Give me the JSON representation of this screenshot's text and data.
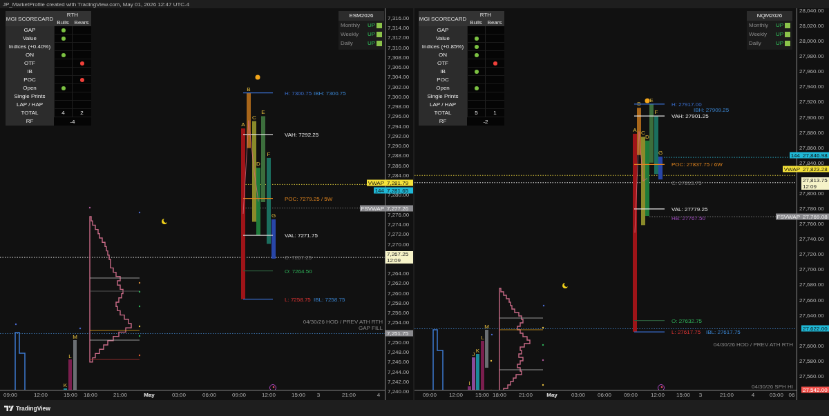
{
  "header": {
    "text": "JP_MarketProfile created with TradingView.com, May 01, 2026 12:47 UTC-4"
  },
  "panes": [
    {
      "symbol": "ESM2026",
      "trend": [
        {
          "period": "Monthly",
          "direction": "UP",
          "up": true
        },
        {
          "period": "Weekly",
          "direction": "UP",
          "up": true
        },
        {
          "period": "Daily",
          "direction": "UP",
          "up": true
        }
      ],
      "scorecard": {
        "title": "MGI SCORECARD",
        "session": "RTH",
        "columns": [
          "Bulls",
          "Bears"
        ],
        "rows": [
          {
            "label": "GAP",
            "bull": true,
            "bear": false
          },
          {
            "label": "Value",
            "bull": true,
            "bear": false
          },
          {
            "label": "Indices (+0.40%)",
            "bull": false,
            "bear": false
          },
          {
            "label": "ON",
            "bull": true,
            "bear": false
          },
          {
            "label": "OTF",
            "bull": false,
            "bear": true
          },
          {
            "label": "IB",
            "bull": false,
            "bear": false
          },
          {
            "label": "POC",
            "bull": false,
            "bear": true
          },
          {
            "label": "Open",
            "bull": true,
            "bear": false
          },
          {
            "label": "Single Prints",
            "bull": false,
            "bear": false
          },
          {
            "label": "LAP / HAP",
            "bull": false,
            "bear": false
          }
        ],
        "total_label": "TOTAL",
        "totals": [
          "4",
          "2"
        ],
        "rf_label": "RF",
        "rf": "-4"
      },
      "periods": [
        {
          "letter": "A",
          "color": "#9e1418"
        },
        {
          "letter": "B",
          "color": "#a8661a"
        },
        {
          "letter": "C",
          "color": "#8a8a2a"
        },
        {
          "letter": "D",
          "color": "#1f7a3a"
        },
        {
          "letter": "E",
          "color": "#3c6e3c"
        },
        {
          "letter": "F",
          "color": "#1b6e5e"
        },
        {
          "letter": "G",
          "color": "#2846a8"
        }
      ],
      "prior_periods": [
        {
          "letter": "K",
          "color": "#1a8a9a"
        },
        {
          "letter": "L",
          "color": "#7a1e4e"
        },
        {
          "letter": "M",
          "color": "#6a6e72"
        }
      ],
      "levels": [
        {
          "text": "H: 7300.75",
          "kind": "high"
        },
        {
          "text": "IBH: 7300.75",
          "kind": "ib"
        },
        {
          "text": "VAH: 7292.25",
          "kind": "value"
        },
        {
          "text": "POC: 7279.25 / 5W",
          "kind": "poc"
        },
        {
          "text": "VAL: 7271.75",
          "kind": "value"
        },
        {
          "text": "C: 7267.25",
          "kind": "close"
        },
        {
          "text": "O: 7264.50",
          "kind": "open"
        },
        {
          "text": "L: 7258.75",
          "kind": "low"
        },
        {
          "text": "IBL: 7258.75",
          "kind": "ib"
        }
      ],
      "notes": [
        "04/30/26 HOD / PREV ATH RTH",
        "GAP FILL"
      ],
      "price_ticks": [
        "7,316.00",
        "7,314.00",
        "7,312.00",
        "7,310.00",
        "7,308.00",
        "7,306.00",
        "7,304.00",
        "7,302.00",
        "7,300.00",
        "7,298.00",
        "7,296.00",
        "7,294.00",
        "7,292.00",
        "7,290.00",
        "7,288.00",
        "7,286.00",
        "7,284.00",
        "7,280.00",
        "7,276.00",
        "7,274.00",
        "7,272.00",
        "7,270.00",
        "7,264.00",
        "7,262.00",
        "7,260.00",
        "7,258.00",
        "7,256.00",
        "7,254.00",
        "7,250.00",
        "7,248.00",
        "7,246.00",
        "7,244.00",
        "7,242.00",
        "7,240.00"
      ],
      "badges": [
        {
          "label": "VWAP",
          "value": "7,281.79",
          "kind": "vwap"
        },
        {
          "label": "144",
          "value": "7,281.65",
          "kind": "ma"
        },
        {
          "label": "FSVWAP",
          "value": "7,277.26",
          "kind": "fsvwap"
        },
        {
          "value": "7,267.25",
          "time": "12:09",
          "kind": "last"
        },
        {
          "value": "7,251.75",
          "kind": "level"
        }
      ],
      "time_ticks": [
        {
          "label": "09:00",
          "major": false
        },
        {
          "label": "12:00",
          "major": false
        },
        {
          "label": "15:00",
          "major": false
        },
        {
          "label": "18:00",
          "major": false
        },
        {
          "label": "21:00",
          "major": false
        },
        {
          "label": "May",
          "major": true
        },
        {
          "label": "03:00",
          "major": false
        },
        {
          "label": "06:00",
          "major": false
        },
        {
          "label": "09:00",
          "major": false
        },
        {
          "label": "12:00",
          "major": false
        },
        {
          "label": "15:00",
          "major": false
        },
        {
          "label": "3",
          "major": false
        },
        {
          "label": "21:00",
          "major": false
        },
        {
          "label": "4",
          "major": false
        }
      ]
    },
    {
      "symbol": "NQM2026",
      "trend": [
        {
          "period": "Monthly",
          "direction": "UP",
          "up": true
        },
        {
          "period": "Weekly",
          "direction": "UP",
          "up": true
        },
        {
          "period": "Daily",
          "direction": "UP",
          "up": true
        }
      ],
      "scorecard": {
        "title": "MGI SCORECARD",
        "session": "RTH",
        "columns": [
          "Bulls",
          "Bears"
        ],
        "rows": [
          {
            "label": "GAP",
            "bull": false,
            "bear": false
          },
          {
            "label": "Value",
            "bull": true,
            "bear": false
          },
          {
            "label": "Indices (+0.85%)",
            "bull": true,
            "bear": false
          },
          {
            "label": "ON",
            "bull": true,
            "bear": false
          },
          {
            "label": "OTF",
            "bull": false,
            "bear": true
          },
          {
            "label": "IB",
            "bull": true,
            "bear": false
          },
          {
            "label": "POC",
            "bull": false,
            "bear": false
          },
          {
            "label": "Open",
            "bull": true,
            "bear": false
          },
          {
            "label": "Single Prints",
            "bull": false,
            "bear": false
          },
          {
            "label": "LAP / HAP",
            "bull": false,
            "bear": false
          }
        ],
        "total_label": "TOTAL",
        "totals": [
          "5",
          "1"
        ],
        "rf_label": "RF",
        "rf": "-2"
      },
      "periods": [
        {
          "letter": "A",
          "color": "#9e1418"
        },
        {
          "letter": "B",
          "color": "#a8661a"
        },
        {
          "letter": "C",
          "color": "#8a8a2a"
        },
        {
          "letter": "D",
          "color": "#1f7a3a"
        },
        {
          "letter": "E",
          "color": "#3c6e3c"
        },
        {
          "letter": "F",
          "color": "#1b6e5e"
        },
        {
          "letter": "G",
          "color": "#2846a8"
        }
      ],
      "prior_periods": [
        {
          "letter": "I",
          "color": "#7a2e6e"
        },
        {
          "letter": "J",
          "color": "#8a4a9a"
        },
        {
          "letter": "K",
          "color": "#1a8a9a"
        },
        {
          "letter": "L",
          "color": "#7a1e4e"
        },
        {
          "letter": "M",
          "color": "#6a6e72"
        }
      ],
      "levels": [
        {
          "text": "H: 27917.00",
          "kind": "high"
        },
        {
          "text": "IBH: 27909.25",
          "kind": "ib"
        },
        {
          "text": "VAH: 27901.25",
          "kind": "value"
        },
        {
          "text": "POC: 27837.75 / 6W",
          "kind": "poc"
        },
        {
          "text": "C: 27813.75",
          "kind": "close"
        },
        {
          "text": "VAL: 27779.25",
          "kind": "value"
        },
        {
          "text": "HB: 27767.50",
          "kind": "hb"
        },
        {
          "text": "O: 27632.75",
          "kind": "open"
        },
        {
          "text": "L: 27617.75",
          "kind": "low"
        },
        {
          "text": "IBL: 27617.75",
          "kind": "ib"
        }
      ],
      "notes": [
        "04/30/26 HOD / PREV ATH RTH",
        "04/30/26 SPH HI"
      ],
      "price_ticks": [
        "28,040.00",
        "28,020.00",
        "28,000.00",
        "27,980.00",
        "27,960.00",
        "27,940.00",
        "27,920.00",
        "27,900.00",
        "27,880.00",
        "27,860.00",
        "27,840.00",
        "27,800.00",
        "27,780.00",
        "27,760.00",
        "27,740.00",
        "27,720.00",
        "27,700.00",
        "27,680.00",
        "27,660.00",
        "27,640.00",
        "27,600.00",
        "27,580.00",
        "27,560.00"
      ],
      "badges": [
        {
          "label": "144",
          "value": "27,846.98",
          "kind": "ma"
        },
        {
          "label": "VWAP",
          "value": "27,823.28",
          "kind": "vwap"
        },
        {
          "value": "27,813.75",
          "time": "12:09",
          "kind": "last"
        },
        {
          "label": "FSVWAP",
          "value": "27,769.08",
          "kind": "fsvwap"
        },
        {
          "value": "27,622.00",
          "kind": "ma"
        },
        {
          "value": "27,542.00",
          "kind": "low"
        }
      ],
      "time_ticks": [
        {
          "label": "09:00",
          "major": false
        },
        {
          "label": "12:00",
          "major": false
        },
        {
          "label": "15:00",
          "major": false
        },
        {
          "label": "18:00",
          "major": false
        },
        {
          "label": "21:00",
          "major": false
        },
        {
          "label": "May",
          "major": true
        },
        {
          "label": "03:00",
          "major": false
        },
        {
          "label": "06:00",
          "major": false
        },
        {
          "label": "09:00",
          "major": false
        },
        {
          "label": "12:00",
          "major": false
        },
        {
          "label": "15:00",
          "major": false
        },
        {
          "label": "3",
          "major": false
        },
        {
          "label": "21:00",
          "major": false
        },
        {
          "label": "4",
          "major": false
        },
        {
          "label": "03:00",
          "major": false
        },
        {
          "label": "06",
          "major": false
        }
      ]
    }
  ],
  "footer": {
    "brand": "TradingView"
  }
}
